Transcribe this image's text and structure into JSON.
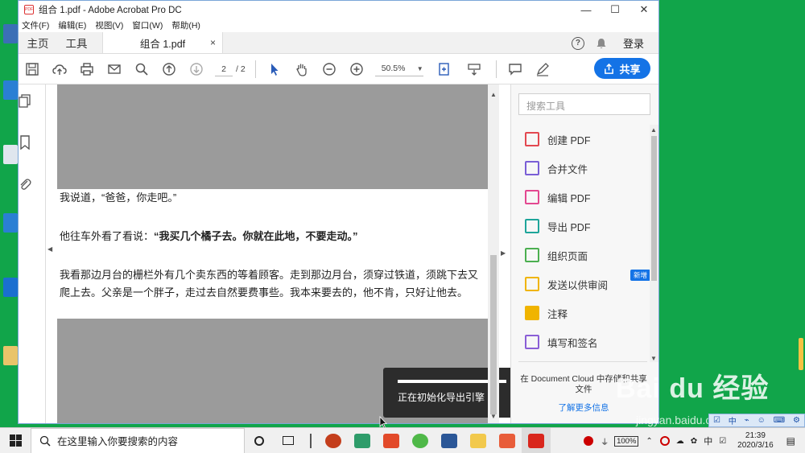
{
  "window": {
    "title": "组合 1.pdf - Adobe Acrobat Pro DC",
    "pdf_icon_glyph": "PDF"
  },
  "menu": [
    "文件(F)",
    "编辑(E)",
    "视图(V)",
    "窗口(W)",
    "帮助(H)"
  ],
  "tabs": {
    "home": "主页",
    "tools": "工具",
    "document": "组合 1.pdf",
    "close": "×",
    "help_glyph": "?",
    "login": "登录"
  },
  "toolbar": {
    "current_page": "2",
    "total_pages": "/ 2",
    "zoom": "50.5%",
    "share": "共享"
  },
  "document": {
    "line1": "我说道，“爸爸，你走吧。”",
    "line2_prefix": "他往车外看了看说：",
    "line2_bold": "“我买几个橘子去。你就在此地，不要走动。”",
    "line3": "我看那边月台的栅栏外有几个卖东西的等着顾客。走到那边月台，须穿过铁道，须跳下去又爬上去。父亲是一个胖子，走过去自然要费事些。我本来要去的，他不肯，只好让他去。"
  },
  "toast": {
    "message": "正在初始化导出引擎",
    "progress": 1.0
  },
  "right_panel": {
    "search_placeholder": "搜索工具",
    "tools": [
      {
        "label": "创建 PDF",
        "color": "#e34850",
        "icon": "create-pdf-icon"
      },
      {
        "label": "合并文件",
        "color": "#7a5fd6",
        "icon": "combine-files-icon"
      },
      {
        "label": "编辑 PDF",
        "color": "#e34890",
        "icon": "edit-pdf-icon"
      },
      {
        "label": "导出 PDF",
        "color": "#1ea59a",
        "icon": "export-pdf-icon"
      },
      {
        "label": "组织页面",
        "color": "#4caf50",
        "icon": "organize-pages-icon"
      },
      {
        "label": "发送以供审阅",
        "color": "#f0b400",
        "icon": "send-review-icon",
        "badge": "新增"
      },
      {
        "label": "注释",
        "color": "#f0b400",
        "icon": "comment-icon"
      },
      {
        "label": "填写和签名",
        "color": "#8a5fd6",
        "icon": "fill-sign-icon"
      }
    ],
    "cloud_text": "在 Document Cloud 中存储和共享文件",
    "learn_more": "了解更多信息"
  },
  "taskbar": {
    "search_placeholder": "在这里输入你要搜索的内容",
    "battery": "100%",
    "ime": "中",
    "time": "21:39",
    "date": "2020/3/16"
  },
  "watermark": {
    "main": "Bai du 经验",
    "sub": "jingyan.baidu.com"
  },
  "colors": {
    "accent": "#1473e6",
    "desktop": "#11a54a"
  }
}
